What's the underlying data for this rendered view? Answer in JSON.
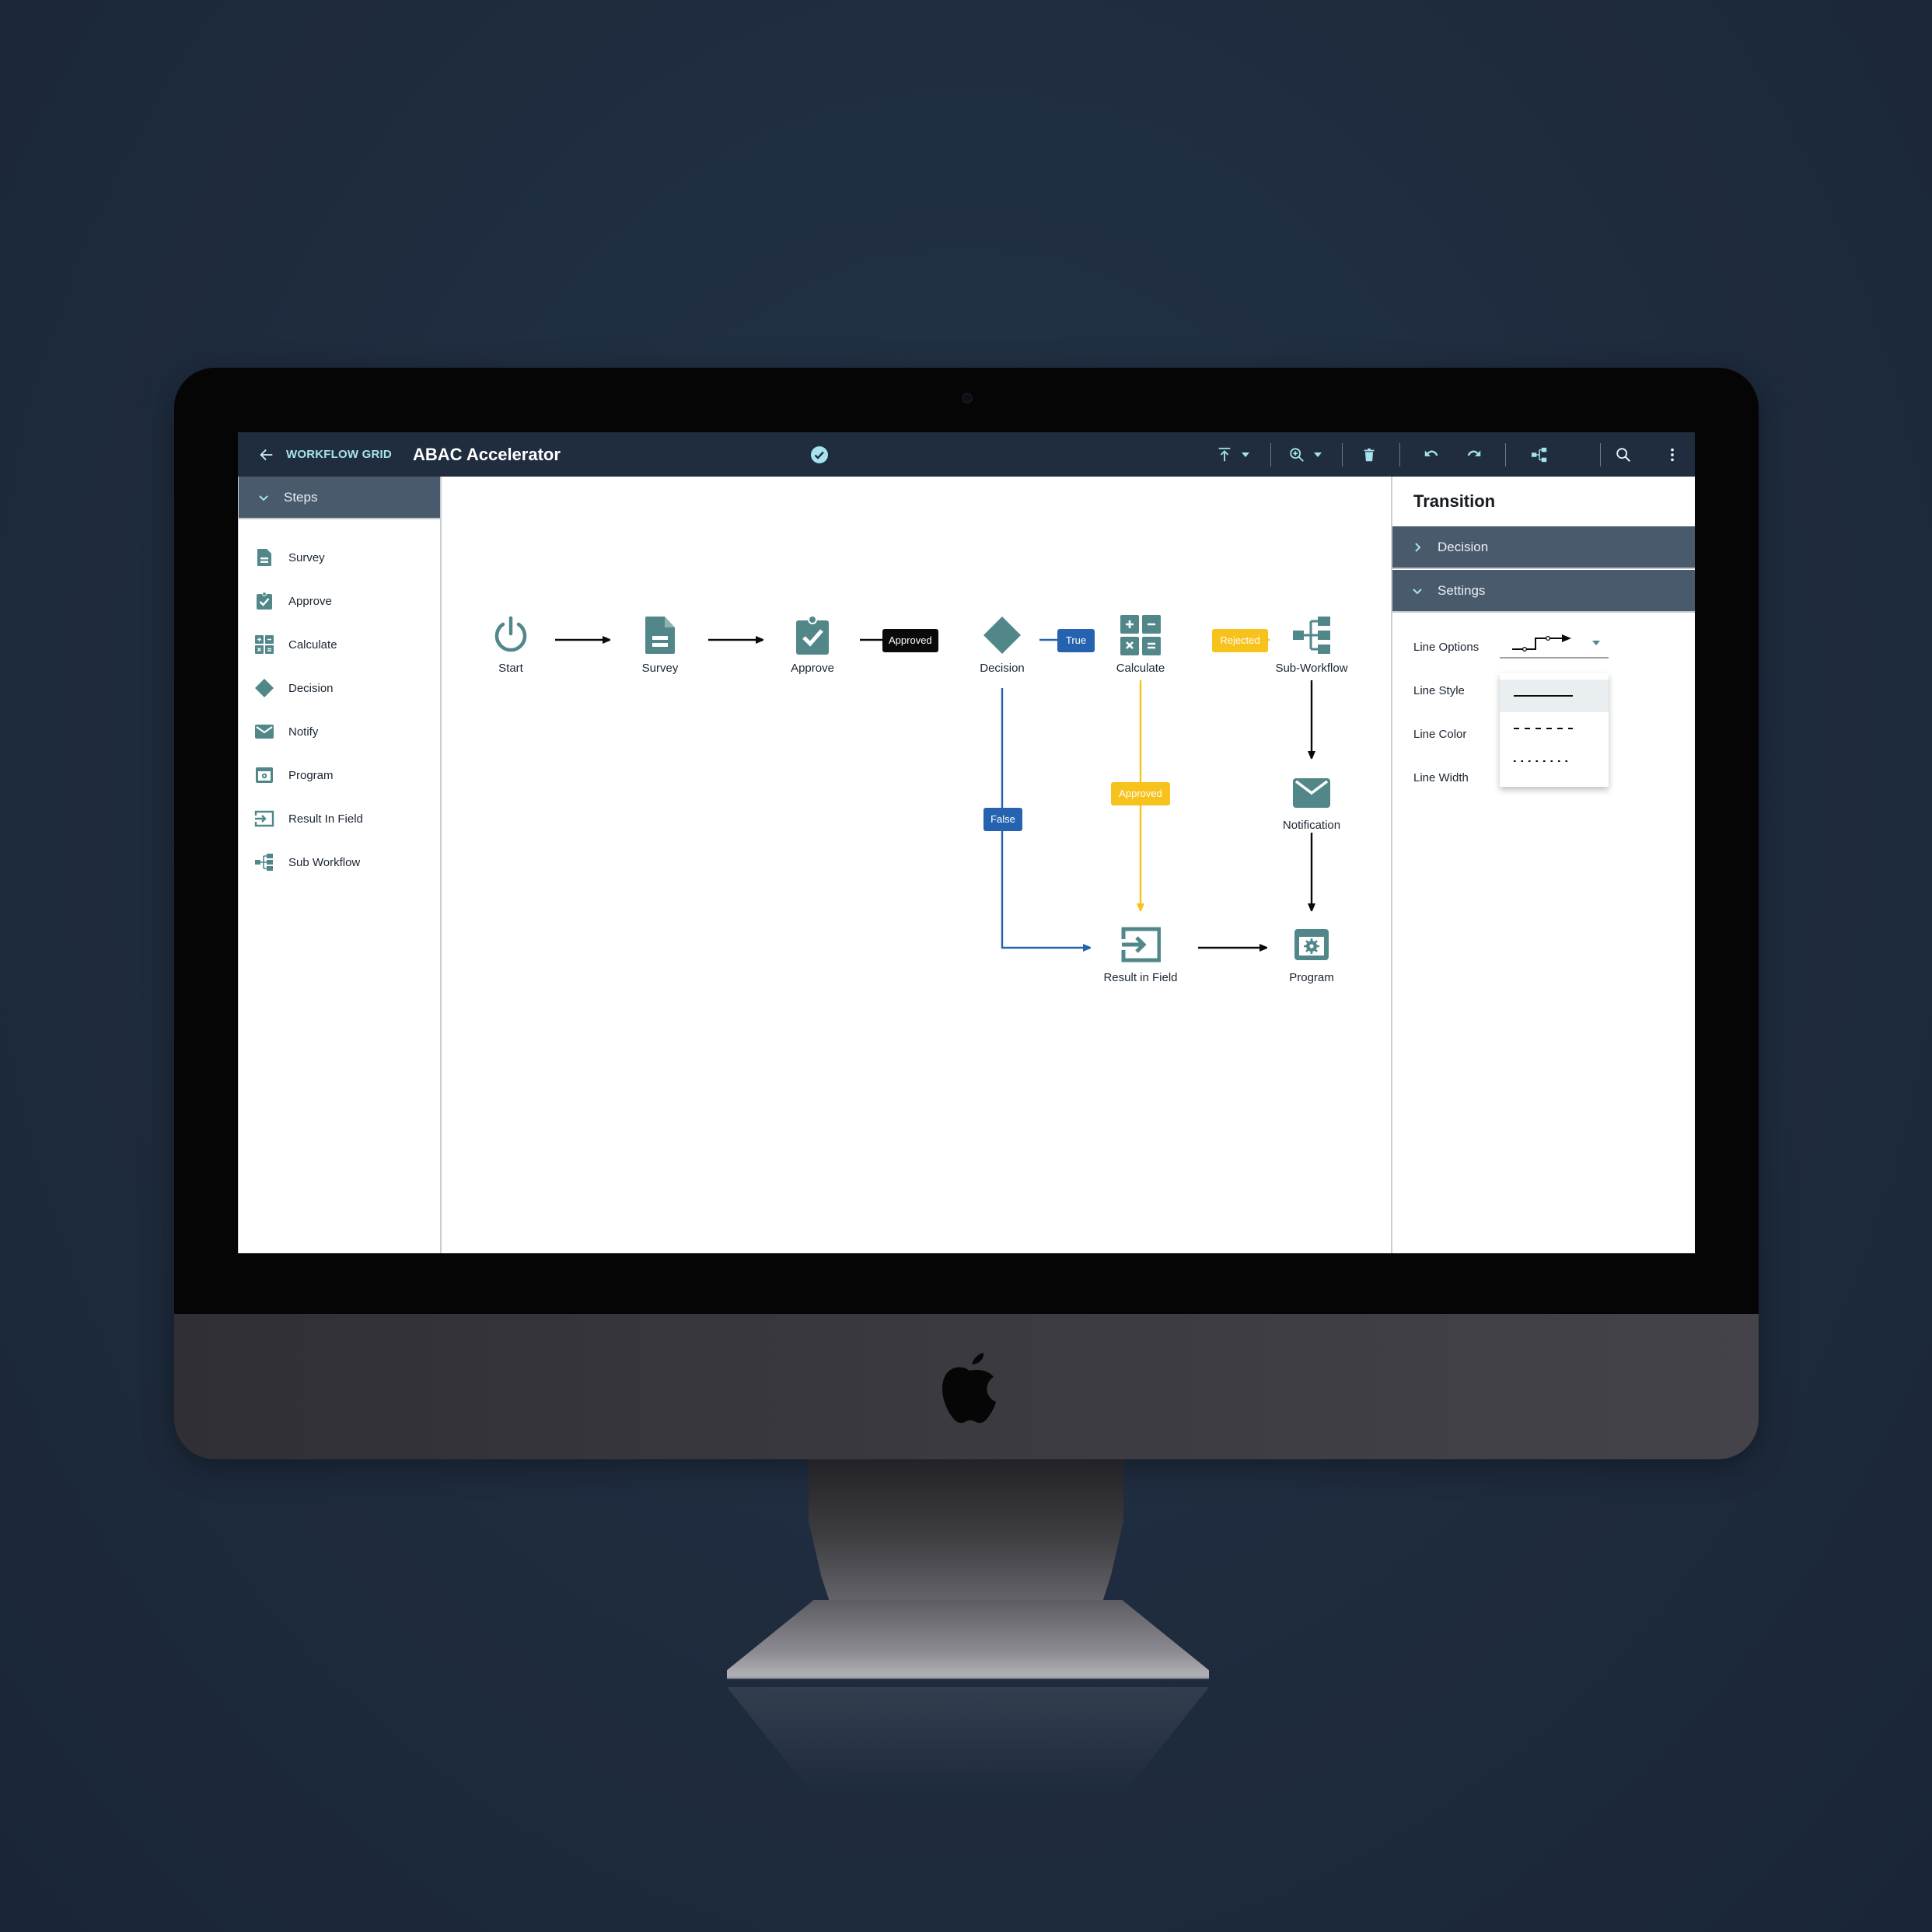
{
  "colors": {
    "background": "#1e2b3d",
    "header_bg": "#1f2d3f",
    "header_accent": "#a7e3ec",
    "panel_header_bg": "#4a5a6d",
    "icon_teal": "#52878a",
    "edge_black": "#0a0a0a",
    "edge_blue": "#2563b0",
    "edge_yellow": "#f7c21b",
    "menu_selected_bg": "#e9eef0"
  },
  "header": {
    "back_label": "WORKFLOW GRID",
    "title": "ABAC Accelerator",
    "status_icon": "check-circle-icon",
    "toolbar": [
      {
        "name": "align-top",
        "icon": "align-top-icon",
        "has_dropdown": true
      },
      {
        "name": "zoom",
        "icon": "zoom-in-icon",
        "has_dropdown": true
      },
      {
        "name": "delete",
        "icon": "trash-icon",
        "has_dropdown": false
      },
      {
        "name": "undo",
        "icon": "undo-icon",
        "has_dropdown": false
      },
      {
        "name": "redo",
        "icon": "redo-icon",
        "has_dropdown": false
      },
      {
        "name": "workflow-map",
        "icon": "workflow-tree-icon",
        "has_dropdown": false
      },
      {
        "name": "search",
        "icon": "search-icon",
        "has_dropdown": false
      },
      {
        "name": "more",
        "icon": "more-vertical-icon",
        "has_dropdown": false
      }
    ]
  },
  "steps_panel": {
    "title": "Steps",
    "expanded": true,
    "items": [
      {
        "label": "Survey",
        "icon": "document-icon"
      },
      {
        "label": "Approve",
        "icon": "clipboard-check-icon"
      },
      {
        "label": "Calculate",
        "icon": "calculator-icon"
      },
      {
        "label": "Decision",
        "icon": "diamond-icon"
      },
      {
        "label": "Notify",
        "icon": "envelope-icon"
      },
      {
        "label": "Program",
        "icon": "program-gear-icon"
      },
      {
        "label": "Result In Field",
        "icon": "result-in-field-icon"
      },
      {
        "label": "Sub Workflow",
        "icon": "sub-workflow-icon"
      }
    ]
  },
  "workflow": {
    "nodes": [
      {
        "id": "start",
        "label": "Start",
        "icon": "power-icon"
      },
      {
        "id": "survey",
        "label": "Survey",
        "icon": "document-icon"
      },
      {
        "id": "approve",
        "label": "Approve",
        "icon": "clipboard-check-icon"
      },
      {
        "id": "decision",
        "label": "Decision",
        "icon": "diamond-icon"
      },
      {
        "id": "calculate",
        "label": "Calculate",
        "icon": "calculator-icon"
      },
      {
        "id": "subworkflow",
        "label": "Sub-Workflow",
        "icon": "sub-workflow-icon"
      },
      {
        "id": "notification",
        "label": "Notification",
        "icon": "envelope-icon"
      },
      {
        "id": "resultinfield",
        "label": "Result in Field",
        "icon": "result-in-field-icon"
      },
      {
        "id": "program",
        "label": "Program",
        "icon": "program-gear-icon"
      }
    ],
    "edges": [
      {
        "from": "start",
        "to": "survey",
        "label": "",
        "color": "black"
      },
      {
        "from": "survey",
        "to": "approve",
        "label": "",
        "color": "black"
      },
      {
        "from": "approve",
        "to": "decision",
        "label": "Approved",
        "color": "black"
      },
      {
        "from": "decision",
        "to": "calculate",
        "label": "True",
        "color": "blue"
      },
      {
        "from": "decision",
        "to": "resultinfield",
        "label": "False",
        "color": "blue"
      },
      {
        "from": "calculate",
        "to": "subworkflow",
        "label": "Rejected",
        "color": "yellow"
      },
      {
        "from": "calculate",
        "to": "resultinfield",
        "label": "Approved",
        "color": "yellow"
      },
      {
        "from": "subworkflow",
        "to": "notification",
        "label": "",
        "color": "black"
      },
      {
        "from": "notification",
        "to": "program",
        "label": "",
        "color": "black"
      },
      {
        "from": "resultinfield",
        "to": "program",
        "label": "",
        "color": "black"
      }
    ]
  },
  "transition_panel": {
    "title": "Transition",
    "sections": [
      {
        "label": "Decision",
        "expanded": false
      },
      {
        "label": "Settings",
        "expanded": true
      }
    ],
    "settings": {
      "line_options_label": "Line Options",
      "line_options_value": "orthogonal-with-waypoints",
      "line_style_label": "Line Style",
      "line_style_value": "solid",
      "line_color_label": "Line Color",
      "line_width_label": "Line Width"
    },
    "line_style_menu": {
      "open": true,
      "options": [
        "solid",
        "dashed",
        "dotted"
      ],
      "selected": "solid"
    }
  }
}
